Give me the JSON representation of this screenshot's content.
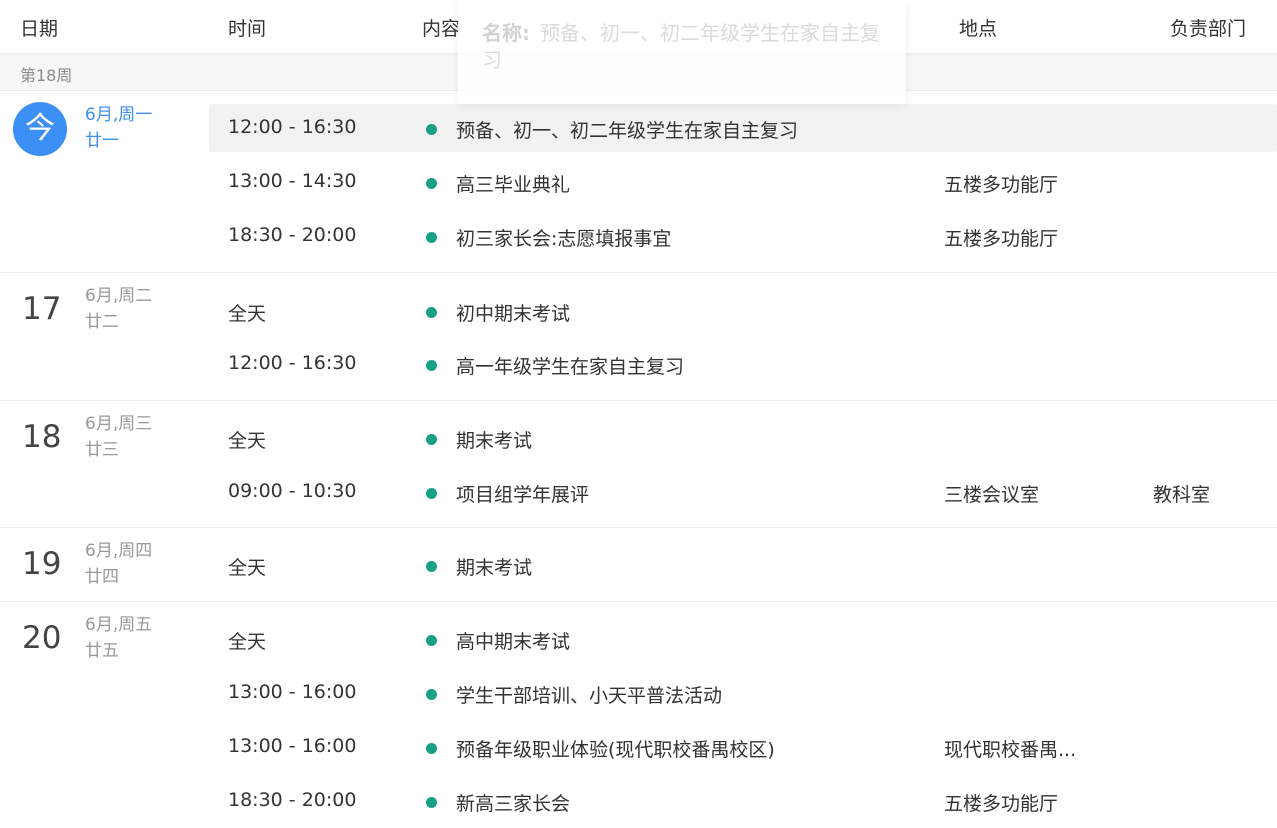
{
  "header": {
    "date": "日期",
    "time": "时间",
    "content": "内容",
    "location": "地点",
    "department": "负责部门"
  },
  "tooltip": {
    "label": "名称:",
    "text": "预备、初一、初二年级学生在家自主复习"
  },
  "week": "第18周",
  "colors": {
    "accent": "#3b8ff5",
    "dot": "#17a085",
    "highlight": "#f2f2f2"
  },
  "days": [
    {
      "badge": "今",
      "meta1": "6月,周一",
      "meta2": "廿一",
      "events": [
        {
          "time": "12:00 - 16:30",
          "content": "预备、初一、初二年级学生在家自主复习",
          "location": "",
          "dept": ""
        },
        {
          "time": "13:00 - 14:30",
          "content": "高三毕业典礼",
          "location": "五楼多功能厅",
          "dept": ""
        },
        {
          "time": "18:30 - 20:00",
          "content": "初三家长会:志愿填报事宜",
          "location": "五楼多功能厅",
          "dept": ""
        }
      ]
    },
    {
      "num": "17",
      "meta1": "6月,周二",
      "meta2": "廿二",
      "events": [
        {
          "time": "全天",
          "content": "初中期末考试",
          "location": "",
          "dept": ""
        },
        {
          "time": "12:00 - 16:30",
          "content": "高一年级学生在家自主复习",
          "location": "",
          "dept": ""
        }
      ]
    },
    {
      "num": "18",
      "meta1": "6月,周三",
      "meta2": "廿三",
      "events": [
        {
          "time": "全天",
          "content": "期末考试",
          "location": "",
          "dept": ""
        },
        {
          "time": "09:00 - 10:30",
          "content": "项目组学年展评",
          "location": "三楼会议室",
          "dept": "教科室"
        }
      ]
    },
    {
      "num": "19",
      "meta1": "6月,周四",
      "meta2": "廿四",
      "events": [
        {
          "time": "全天",
          "content": "期末考试",
          "location": "",
          "dept": ""
        }
      ]
    },
    {
      "num": "20",
      "meta1": "6月,周五",
      "meta2": "廿五",
      "events": [
        {
          "time": "全天",
          "content": "高中期末考试",
          "location": "",
          "dept": ""
        },
        {
          "time": "13:00 - 16:00",
          "content": "学生干部培训、小天平普法活动",
          "location": "",
          "dept": ""
        },
        {
          "time": "13:00 - 16:00",
          "content": "预备年级职业体验(现代职校番禺校区)",
          "location": "现代职校番禺...",
          "dept": ""
        },
        {
          "time": "18:30 - 20:00",
          "content": "新高三家长会",
          "location": "五楼多功能厅",
          "dept": ""
        }
      ]
    }
  ]
}
